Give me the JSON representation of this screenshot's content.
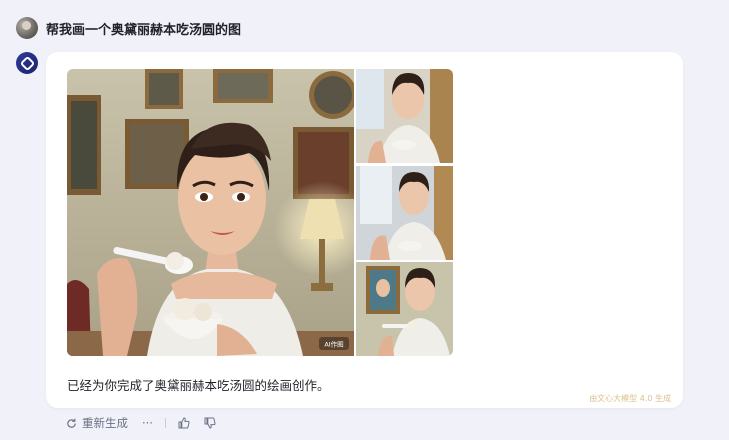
{
  "conversation": {
    "user_message": "帮我画一个奥黛丽赫本吃汤圆的图",
    "assistant_reply": "已经为你完成了奥黛丽赫本吃汤圆的绘画创作。",
    "ai_badge": "AI作图",
    "watermark": "由文心大模型 4.0 生成"
  },
  "actions": {
    "regenerate_label": "重新生成",
    "more_label": "···"
  },
  "icons": {
    "user_avatar": "user-avatar",
    "bot_avatar": "ernie-bot-logo",
    "regenerate": "refresh-icon",
    "more": "more-icon",
    "like": "thumbs-up-icon",
    "dislike": "thumbs-down-icon"
  },
  "colors": {
    "page_background": "#f1f2f9",
    "bubble": "#ffffff",
    "bot_avatar": "#2f3a9e",
    "watermark": "#d9c38b"
  }
}
